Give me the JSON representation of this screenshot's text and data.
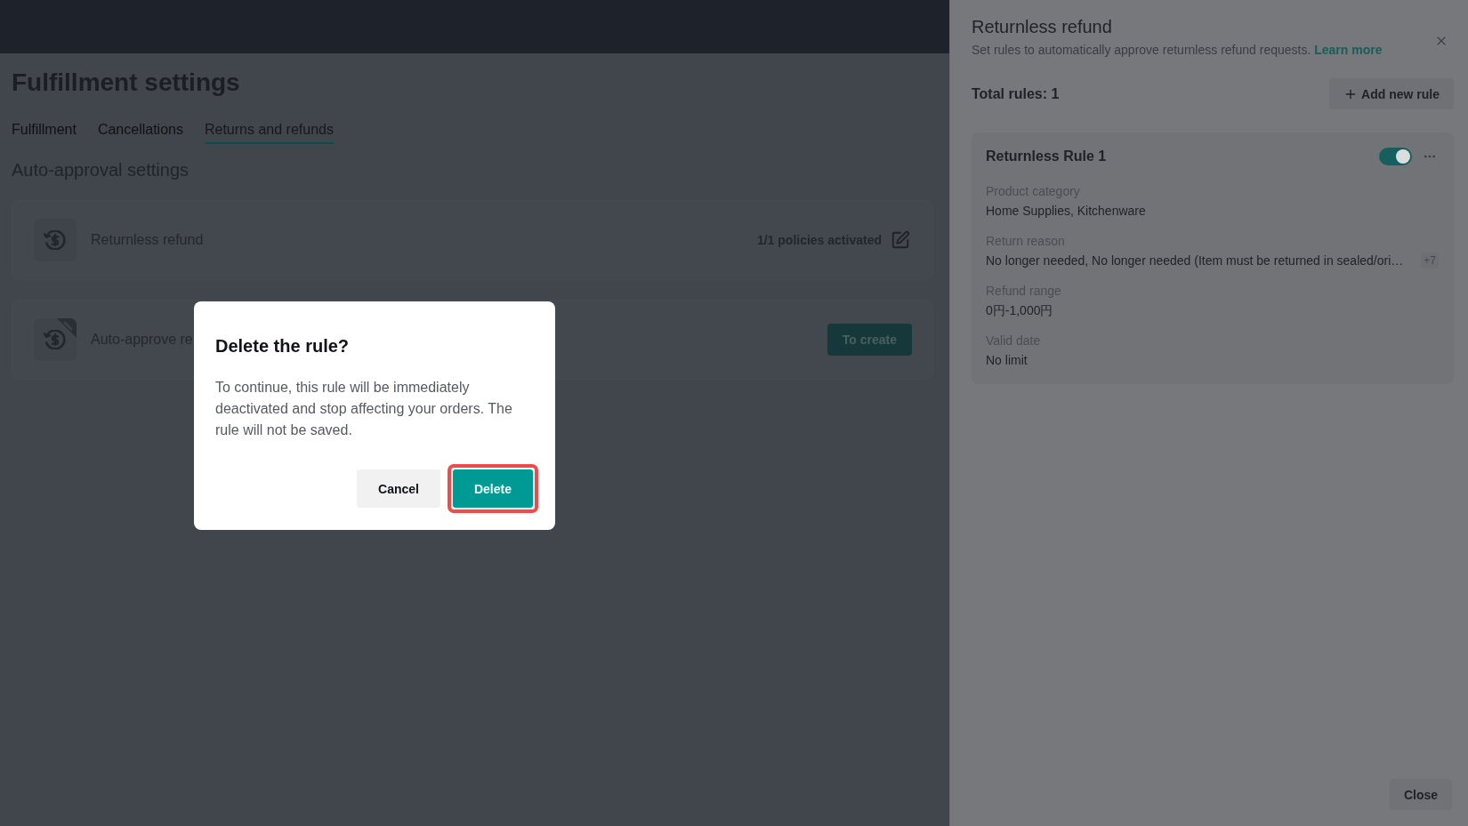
{
  "page": {
    "title": "Fulfillment settings",
    "tabs": [
      {
        "label": "Fulfillment",
        "selected": false
      },
      {
        "label": "Cancellations",
        "selected": false
      },
      {
        "label": "Returns and refunds",
        "selected": true
      }
    ],
    "section_title": "Auto-approval settings",
    "settings": [
      {
        "kind": "status",
        "name": "Returnless refund",
        "status": "1/1 policies activated",
        "corner_badge": false
      },
      {
        "kind": "create",
        "name": "Auto-approve re",
        "action": "To create",
        "corner_badge": true
      }
    ]
  },
  "dialog": {
    "title": "Delete the rule?",
    "message": "To continue, this rule will be immediately deactivated and stop affecting your orders. The rule will not be saved.",
    "buttons": [
      {
        "kind": "secondary",
        "label": "Cancel",
        "highlighted": false
      },
      {
        "kind": "primary",
        "label": "Delete",
        "highlighted": true
      }
    ]
  },
  "drawer": {
    "title": "Returnless refund",
    "description": "Set rules to automatically approve returnless refund requests.",
    "link": "Learn more",
    "total": "Total rules: 1",
    "add_button": "Add new rule",
    "rules": [
      {
        "name": "Returnless Rule 1",
        "on": true,
        "fields": [
          {
            "label": "Product category",
            "value": "Home Supplies, Kitchenware"
          },
          {
            "label": "Return reason",
            "value": "No longer needed, No longer needed (Item must be returned in sealed/ori…",
            "extra": "+7"
          },
          {
            "label": "Refund range",
            "value": "0円-1,000円"
          },
          {
            "label": "Valid date",
            "value": "No limit"
          }
        ]
      }
    ],
    "close_button": "Close"
  }
}
